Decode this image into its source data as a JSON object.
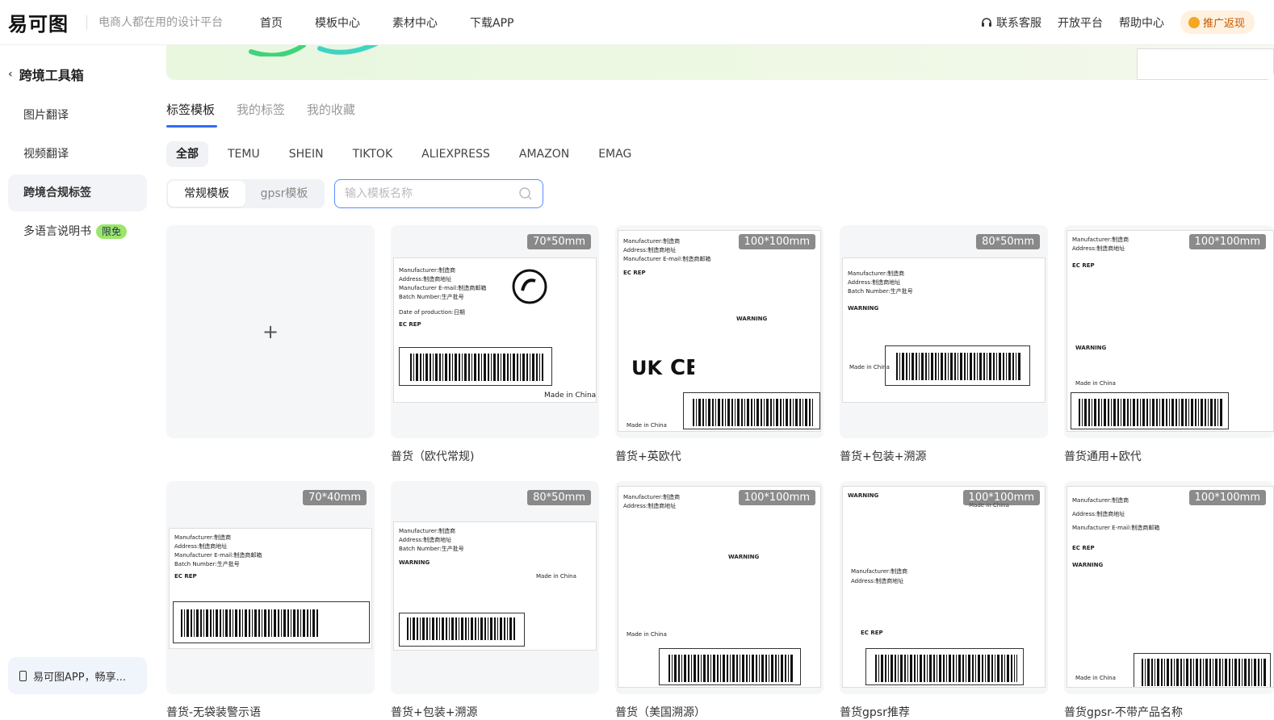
{
  "header": {
    "logo": "易可图",
    "slogan": "电商人都在用的设计平台",
    "nav": [
      "首页",
      "模板中心",
      "素材中心",
      "下载APP"
    ],
    "right": {
      "support": "联系客服",
      "open": "开放平台",
      "help": "帮助中心",
      "promo": "推广返现"
    }
  },
  "sidebar": {
    "title": "跨境工具箱",
    "items": [
      {
        "label": "图片翻译"
      },
      {
        "label": "视频翻译"
      },
      {
        "label": "跨境合规标签"
      },
      {
        "label": "多语言说明书",
        "badge": "限免"
      }
    ],
    "app": "易可图APP，畅享..."
  },
  "tabs": [
    "标签模板",
    "我的标签",
    "我的收藏"
  ],
  "platforms": [
    "全部",
    "TEMU",
    "SHEIN",
    "TIKTOK",
    "ALIEXPRESS",
    "AMAZON",
    "EMAG"
  ],
  "segment": [
    "常规模板",
    "gpsr模板"
  ],
  "search": {
    "placeholder": "输入模板名称"
  },
  "create": {
    "symbol": "+"
  },
  "cards": [
    {
      "size": "70*50mm",
      "title": "普货（欧代常规)"
    },
    {
      "size": "100*100mm",
      "title": "普货+英欧代"
    },
    {
      "size": "80*50mm",
      "title": "普货+包装+溯源"
    },
    {
      "size": "100*100mm",
      "title": "普货通用+欧代"
    },
    {
      "size": "70*40mm",
      "title": "普货-无袋装警示语"
    },
    {
      "size": "80*50mm",
      "title": "普货+包装+溯源"
    },
    {
      "size": "100*100mm",
      "title": "普货（美国溯源）"
    },
    {
      "size": "100*100mm",
      "title": "普货gpsr推荐"
    },
    {
      "size": "100*100mm",
      "title": "普货gpsr-不带产品名称"
    }
  ],
  "label_text": {
    "manufacturer": "Manufacturer:制造商",
    "address": "Address:制造商地址",
    "email": "Manufacturer E-mail:制造商邮箱",
    "batch": "Batch Number:生产批号",
    "date": "Date of production:日期",
    "made": "Made in China",
    "warning": "WARNING",
    "ecrep": "EC REP"
  },
  "colors": {
    "accent": "#2f6bff",
    "badge": "#9be66a"
  }
}
